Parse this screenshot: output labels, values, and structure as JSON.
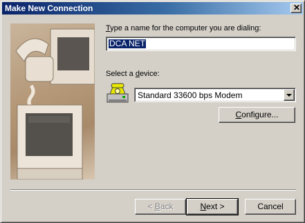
{
  "window": {
    "title": "Make New Connection",
    "close_glyph": "✕"
  },
  "form": {
    "name_label_first": "T",
    "name_label_rest": "ype a name for the computer you are dialing:",
    "name_value": "DCA NET",
    "device_label_first": "Select a ",
    "device_label_hot": "d",
    "device_label_rest": "evice:",
    "device_value": "Standard 33600 bps Modem",
    "configure_hot": "C",
    "configure_rest": "onfigure..."
  },
  "buttons": {
    "back_prefix": "< ",
    "back_hot": "B",
    "back_rest": "ack",
    "next_hot": "N",
    "next_rest": "ext >",
    "cancel": "Cancel"
  },
  "icons": {
    "modem": "modem-phone-icon",
    "close": "close-icon",
    "dropdown": "chevron-down-icon"
  }
}
